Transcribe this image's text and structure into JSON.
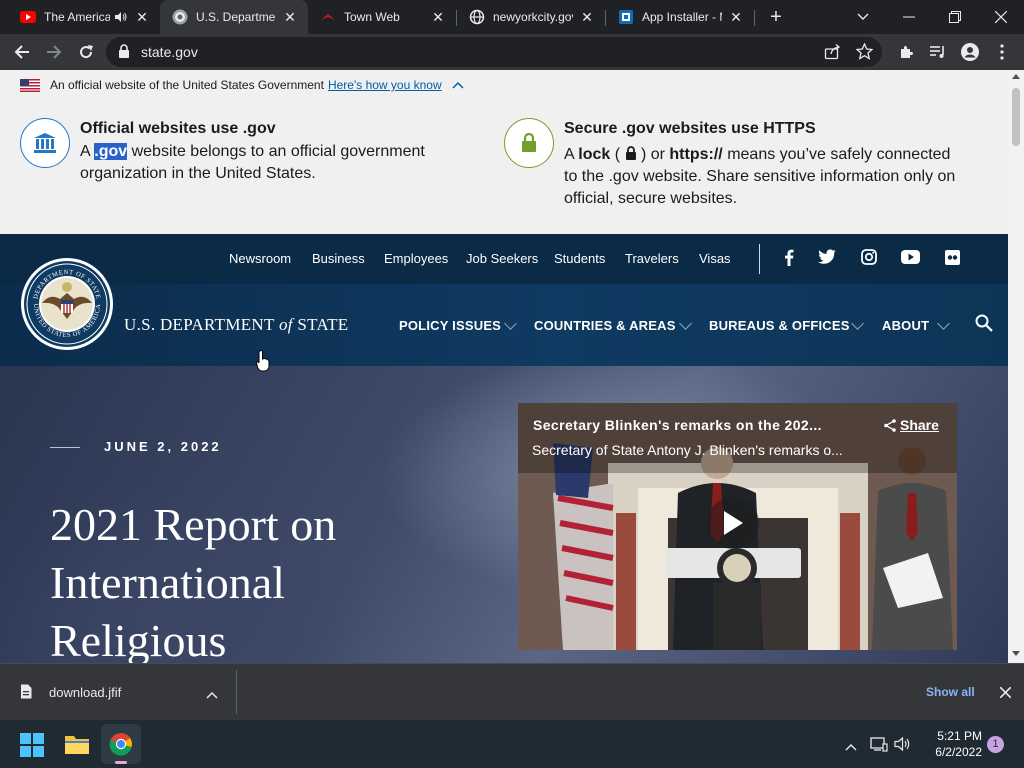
{
  "tabs": [
    {
      "title": "The American Legion",
      "favicon": "youtube-icon",
      "audio": true,
      "active": false
    },
    {
      "title": "U.S. Department of State",
      "favicon": "state-seal-icon",
      "active": true
    },
    {
      "title": "Town Web",
      "favicon": "townweb-icon",
      "active": false
    },
    {
      "title": "newyorkcity.gov",
      "favicon": "globe-icon",
      "active": false
    },
    {
      "title": "App Installer - M",
      "favicon": "app-installer-icon",
      "active": false
    }
  ],
  "toolbar": {
    "url": "state.gov"
  },
  "gov_banner": {
    "official_text": "An official website of the United States Government",
    "how_you_know": "Here's how you know",
    "official_head": "Official websites use .gov",
    "official_a": "A",
    "official_gov": ".gov",
    "official_line1_rest": "website belongs to an official government",
    "official_line2": "organization in the United States.",
    "secure_head": "Secure .gov websites use HTTPS",
    "secure_a": "A",
    "secure_lock": "lock",
    "secure_or": ") or",
    "secure_https": "https://",
    "secure_line1_rest": "means you’ve safely connected",
    "secure_line2": "to the .gov website. Share sensitive information only on",
    "secure_line3": "official, secure websites."
  },
  "topnav": {
    "links": [
      "Newsroom",
      "Business",
      "Employees",
      "Job Seekers",
      "Students",
      "Travelers",
      "Visas"
    ],
    "social": [
      "facebook-icon",
      "twitter-icon",
      "instagram-icon",
      "youtube-icon",
      "flickr-icon"
    ]
  },
  "site": {
    "name_left": "U.S. DEPARTMENT",
    "name_of": "of",
    "name_right": "STATE",
    "seal_top": "DEPARTMENT OF STATE",
    "seal_bottom": "UNITED STATES OF AMERICA"
  },
  "mainnav": [
    "POLICY ISSUES",
    "COUNTRIES & AREAS",
    "BUREAUS & OFFICES",
    "ABOUT"
  ],
  "hero": {
    "date": "JUNE 2, 2022",
    "title_lines": [
      "2021 Report on",
      "International",
      "Religious"
    ]
  },
  "video": {
    "title": "Secretary Blinken's remarks on the 202...",
    "subtitle": "Secretary of State Antony J. Blinken's remarks o...",
    "share": "Share"
  },
  "download": {
    "filename": "download.jfif",
    "show_all": "Show all"
  },
  "taskbar": {
    "time": "5:21 PM",
    "date": "6/2/2022",
    "notification_count": "1"
  },
  "colors": {
    "chrome_dark": "#202124",
    "chrome_toolbar": "#35363a",
    "state_navy": "#0b2a46",
    "gov_link": "#005ea2",
    "https_green": "#4f8a10"
  }
}
